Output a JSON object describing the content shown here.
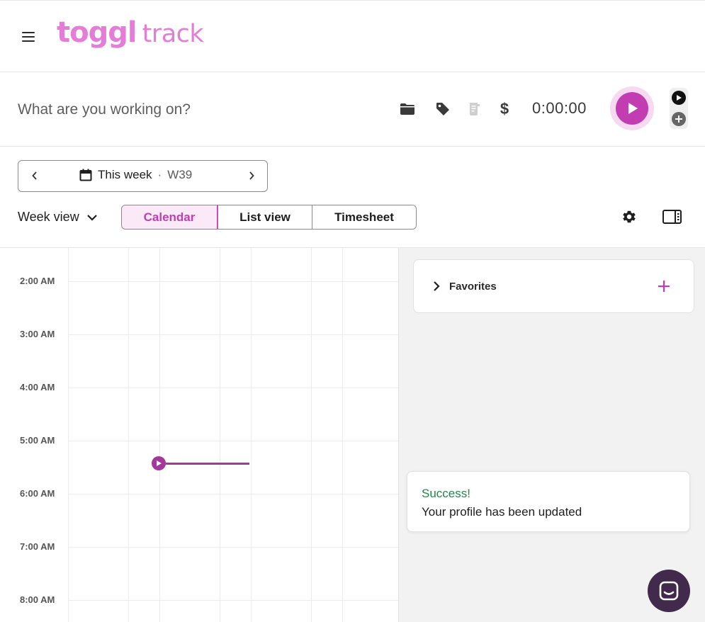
{
  "header": {
    "logo_word": "toggl",
    "logo_product": "track"
  },
  "timer": {
    "placeholder": "What are you working on?",
    "elapsed": "0:00:00",
    "icons": [
      "folder-icon",
      "tag-icon",
      "receipt-icon",
      "dollar-icon"
    ],
    "dollar_symbol": "$"
  },
  "toolbar": {
    "week_label": "This week",
    "week_separator": "·",
    "week_number": "W39",
    "view_mode": "Week view",
    "tabs": [
      {
        "label": "Calendar",
        "active": true
      },
      {
        "label": "List view",
        "active": false
      },
      {
        "label": "Timesheet",
        "active": false
      }
    ]
  },
  "calendar": {
    "hours": [
      "2:00 AM",
      "3:00 AM",
      "4:00 AM",
      "5:00 AM",
      "6:00 AM",
      "7:00 AM",
      "8:00 AM"
    ]
  },
  "sidebar": {
    "favorites_title": "Favorites"
  },
  "toast": {
    "title": "Success!",
    "message": "Your profile has been updated"
  },
  "colors": {
    "brand": "#e57cd8",
    "accent": "#c23db2",
    "success": "#1a8a4a",
    "chat": "#412a4c"
  }
}
